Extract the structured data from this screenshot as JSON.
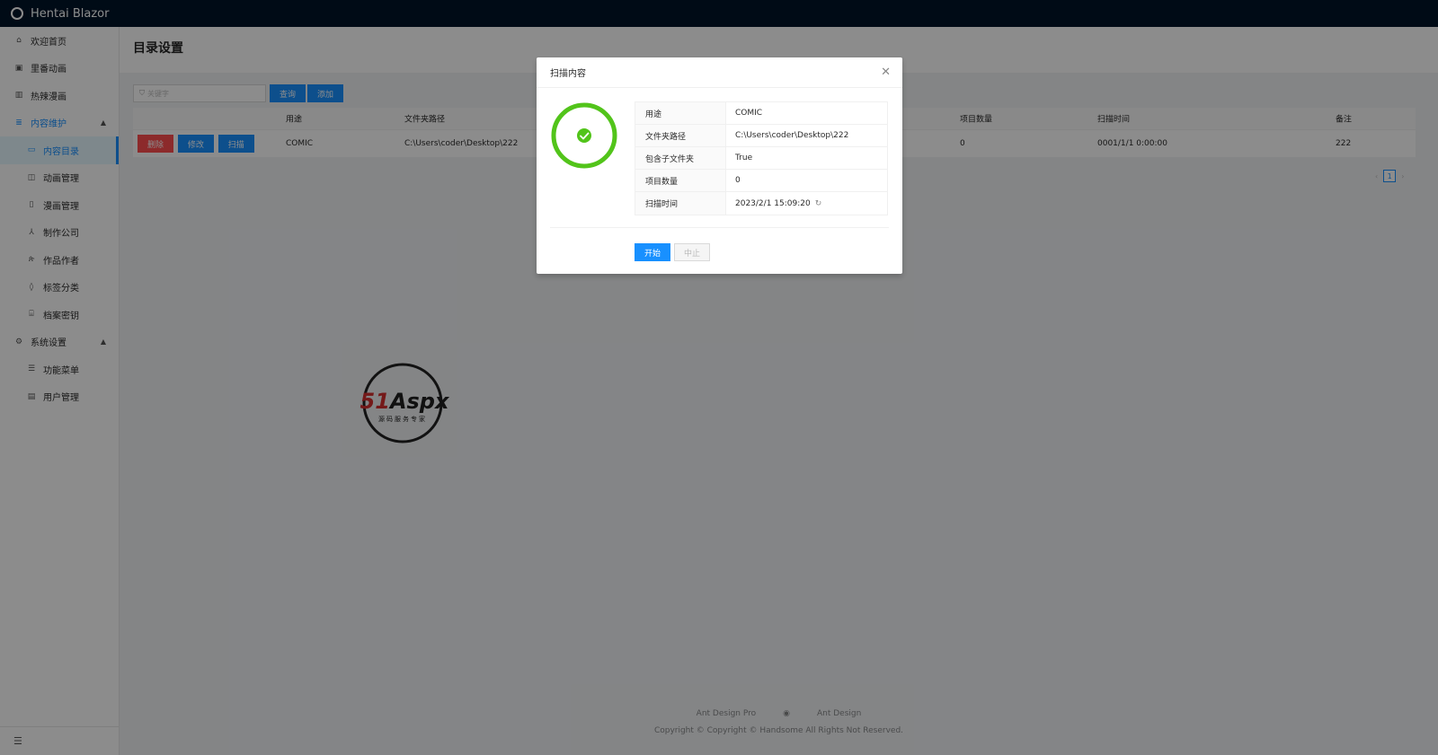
{
  "app": {
    "title": "Hentai Blazor"
  },
  "sidebar": {
    "items": [
      {
        "label": "欢迎首页",
        "icon": "home-icon"
      },
      {
        "label": "里番动画",
        "icon": "play-square-icon"
      },
      {
        "label": "热辣漫画",
        "icon": "book-icon"
      },
      {
        "label": "内容维护",
        "icon": "database-icon",
        "open": true,
        "children": [
          {
            "label": "内容目录",
            "icon": "folder-icon",
            "selected": true
          },
          {
            "label": "动画管理",
            "icon": "video-icon"
          },
          {
            "label": "漫画管理",
            "icon": "file-icon"
          },
          {
            "label": "制作公司",
            "icon": "cluster-icon"
          },
          {
            "label": "作品作者",
            "icon": "user-icon"
          },
          {
            "label": "标签分类",
            "icon": "tag-icon"
          },
          {
            "label": "档案密钥",
            "icon": "key-icon"
          }
        ]
      },
      {
        "label": "系统设置",
        "icon": "setting-icon",
        "open": true,
        "children": [
          {
            "label": "功能菜单",
            "icon": "menu-icon"
          },
          {
            "label": "用户管理",
            "icon": "idcard-icon"
          }
        ]
      }
    ]
  },
  "page": {
    "title": "目录设置"
  },
  "toolbar": {
    "search_placeholder": "关键字",
    "query_label": "查询",
    "add_label": "添加"
  },
  "table": {
    "headers": [
      "用途",
      "文件夹路径",
      "项目数量",
      "扫描时间",
      "备注"
    ],
    "rows": [
      {
        "delete": "删除",
        "edit": "修改",
        "scan": "扫描",
        "purpose": "COMIC",
        "path": "C:\\Users\\coder\\Desktop\\222",
        "count": "0",
        "scan_time": "0001/1/1 0:00:00",
        "note": "222"
      }
    ]
  },
  "pagination": {
    "prev": "‹",
    "current": "1",
    "next": "›"
  },
  "footer": {
    "link1": "Ant Design Pro",
    "link2": "Ant Design",
    "copyright": "Copyright © Copyright © Handsome All Rights Not Reserved."
  },
  "modal": {
    "title": "扫描内容",
    "progress_percent": 100,
    "rows": [
      {
        "label": "用途",
        "value": "COMIC"
      },
      {
        "label": "文件夹路径",
        "value": "C:\\Users\\coder\\Desktop\\222"
      },
      {
        "label": "包含子文件夹",
        "value": "True"
      },
      {
        "label": "项目数量",
        "value": "0"
      },
      {
        "label": "扫描时间",
        "value": "2023/2/1 15:09:20"
      }
    ],
    "start_label": "开始",
    "stop_label": "中止"
  },
  "watermark": {
    "brand": "51Aspx",
    "tagline": "源码服务专家"
  },
  "colors": {
    "accent": "#1890ff",
    "success": "#52c41a",
    "danger": "#ff4d4f",
    "header_bg": "#001529"
  }
}
